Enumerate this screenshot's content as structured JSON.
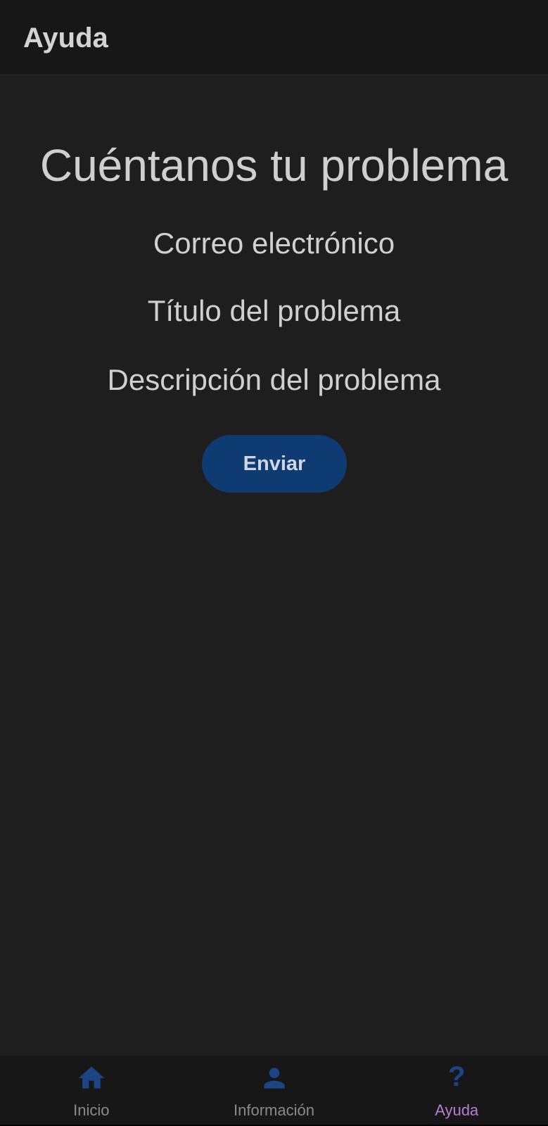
{
  "app_bar": {
    "title": "Ayuda"
  },
  "form": {
    "heading": "Cuéntanos tu problema",
    "email_label": "Correo electrónico",
    "title_label": "Título del problema",
    "description_label": "Descripción del problema",
    "submit_label": "Enviar"
  },
  "bottom_nav": {
    "items": [
      {
        "label": "Inicio",
        "icon": "home-icon",
        "active": false
      },
      {
        "label": "Información",
        "icon": "person-icon",
        "active": false
      },
      {
        "label": "Ayuda",
        "icon": "help-icon",
        "active": true
      }
    ]
  },
  "colors": {
    "background": "#1e1e1f",
    "app_bar": "#171717",
    "button": "#0e3b72",
    "nav_icon": "#1d4586",
    "active_label": "#b47fd0",
    "inactive_label": "#8a8a8a"
  }
}
